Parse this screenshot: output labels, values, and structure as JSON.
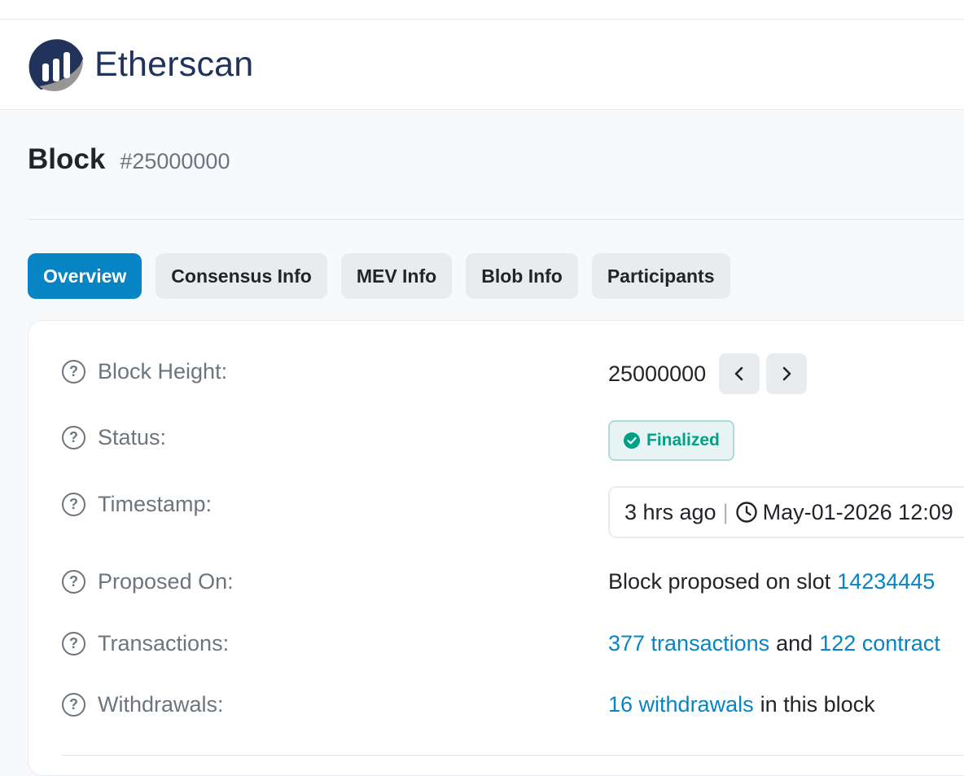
{
  "header": {
    "brand": "Etherscan"
  },
  "page": {
    "title": "Block",
    "block_ref": "#25000000"
  },
  "tabs": [
    {
      "label": "Overview",
      "active": true
    },
    {
      "label": "Consensus Info",
      "active": false
    },
    {
      "label": "MEV Info",
      "active": false
    },
    {
      "label": "Blob Info",
      "active": false
    },
    {
      "label": "Participants",
      "active": false
    }
  ],
  "overview": {
    "block_height": {
      "label": "Block Height:",
      "value": "25000000"
    },
    "status": {
      "label": "Status:",
      "value": "Finalized"
    },
    "timestamp": {
      "label": "Timestamp:",
      "relative": "3 hrs ago",
      "separator": "|",
      "absolute": "May-01-2026 12:09"
    },
    "proposed_on": {
      "label": "Proposed On:",
      "prefix": "Block proposed on slot",
      "slot": "14234445"
    },
    "transactions": {
      "label": "Transactions:",
      "tx_link": "377 transactions",
      "joiner": "and",
      "contract_link": "122 contract"
    },
    "withdrawals": {
      "label": "Withdrawals:",
      "link": "16 withdrawals",
      "suffix": "in this block"
    }
  },
  "icons": {
    "help": "question-circle-icon",
    "prev": "chevron-left-icon",
    "next": "chevron-right-icon",
    "status": "check-circle-icon",
    "clock": "clock-icon"
  },
  "colors": {
    "brand_dark": "#21325b",
    "accent": "#0784c3",
    "success": "#00a186",
    "muted": "#6c757d"
  }
}
